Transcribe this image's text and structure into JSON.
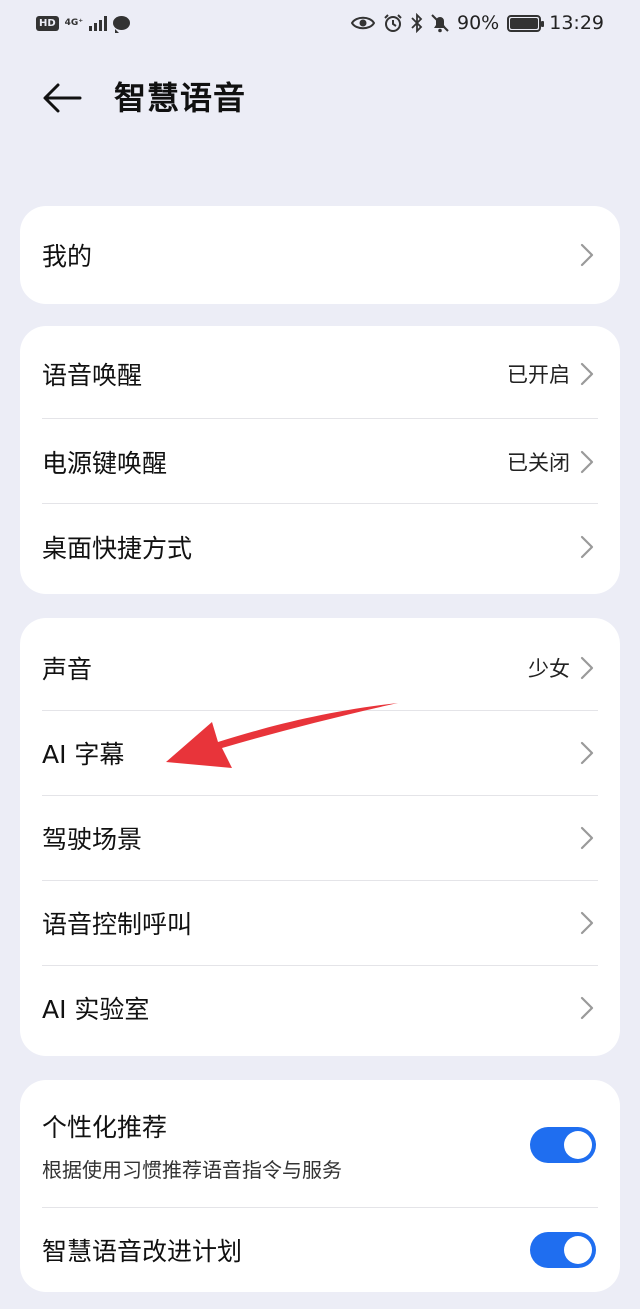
{
  "status_bar": {
    "hd_label": "HD",
    "network_label": "4G⁺",
    "battery_percent": "90%",
    "time": "13:29",
    "icons": [
      "eye-icon",
      "alarm-icon",
      "bluetooth-icon",
      "mute-bell-icon",
      "battery-icon"
    ]
  },
  "header": {
    "title": "智慧语音"
  },
  "section_mine": {
    "label": "我的"
  },
  "section_wake": {
    "items": [
      {
        "label": "语音唤醒",
        "value": "已开启"
      },
      {
        "label": "电源键唤醒",
        "value": "已关闭"
      },
      {
        "label": "桌面快捷方式",
        "value": ""
      }
    ]
  },
  "section_features": {
    "items": [
      {
        "label": "声音",
        "value": "少女"
      },
      {
        "label": "AI 字幕",
        "value": ""
      },
      {
        "label": "驾驶场景",
        "value": ""
      },
      {
        "label": "语音控制呼叫",
        "value": ""
      },
      {
        "label": "AI 实验室",
        "value": ""
      }
    ]
  },
  "section_privacy": {
    "items": [
      {
        "label": "个性化推荐",
        "sublabel": "根据使用习惯推荐语音指令与服务",
        "enabled": true
      },
      {
        "label": "智慧语音改进计划",
        "enabled": true
      }
    ]
  },
  "colors": {
    "background": "#ecedf6",
    "card": "#ffffff",
    "toggle_on": "#1f6ef0",
    "annotation_arrow": "#e8343a"
  }
}
